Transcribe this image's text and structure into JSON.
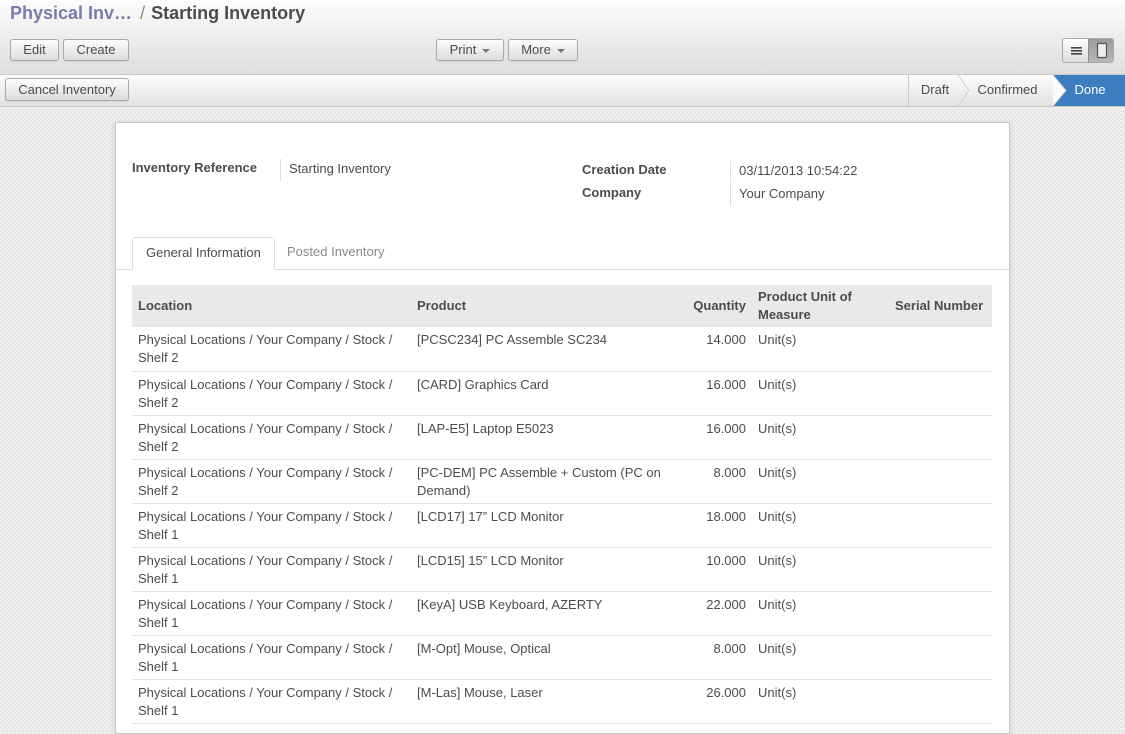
{
  "breadcrumb": {
    "parent": "Physical Inv…",
    "separator": "/",
    "current": "Starting Inventory"
  },
  "toolbar": {
    "edit": "Edit",
    "create": "Create",
    "print": "Print",
    "more": "More"
  },
  "view_switch": {
    "list_icon": "list-view-icon",
    "form_icon": "form-view-icon",
    "active": "form"
  },
  "status_bar": {
    "cancel": "Cancel Inventory",
    "steps": [
      "Draft",
      "Confirmed",
      "Done"
    ],
    "current": "Done",
    "current_color": "#3c7dc0"
  },
  "form": {
    "inventory_reference": {
      "label": "Inventory Reference",
      "value": "Starting Inventory"
    },
    "creation_date": {
      "label": "Creation Date",
      "value": "03/11/2013 10:54:22"
    },
    "company": {
      "label": "Company",
      "value": "Your Company"
    }
  },
  "tabs": [
    {
      "label": "General Information",
      "active": true
    },
    {
      "label": "Posted Inventory",
      "active": false
    }
  ],
  "table": {
    "columns": [
      "Location",
      "Product",
      "Quantity",
      "Product Unit of Measure",
      "Serial Number"
    ],
    "rows": [
      {
        "location": "Physical Locations / Your Company / Stock / Shelf 2",
        "product": "[PCSC234] PC Assemble SC234",
        "quantity": "14.000",
        "uom": "Unit(s)",
        "serial": ""
      },
      {
        "location": "Physical Locations / Your Company / Stock / Shelf 2",
        "product": "[CARD] Graphics Card",
        "quantity": "16.000",
        "uom": "Unit(s)",
        "serial": ""
      },
      {
        "location": "Physical Locations / Your Company / Stock / Shelf 2",
        "product": "[LAP-E5] Laptop E5023",
        "quantity": "16.000",
        "uom": "Unit(s)",
        "serial": ""
      },
      {
        "location": "Physical Locations / Your Company / Stock / Shelf 2",
        "product": "[PC-DEM] PC Assemble + Custom (PC on Demand)",
        "quantity": "8.000",
        "uom": "Unit(s)",
        "serial": ""
      },
      {
        "location": "Physical Locations / Your Company / Stock / Shelf 1",
        "product": "[LCD17] 17” LCD Monitor",
        "quantity": "18.000",
        "uom": "Unit(s)",
        "serial": ""
      },
      {
        "location": "Physical Locations / Your Company / Stock / Shelf 1",
        "product": "[LCD15] 15” LCD Monitor",
        "quantity": "10.000",
        "uom": "Unit(s)",
        "serial": ""
      },
      {
        "location": "Physical Locations / Your Company / Stock / Shelf 1",
        "product": "[KeyA] USB Keyboard, AZERTY",
        "quantity": "22.000",
        "uom": "Unit(s)",
        "serial": ""
      },
      {
        "location": "Physical Locations / Your Company / Stock / Shelf 1",
        "product": "[M-Opt] Mouse, Optical",
        "quantity": "8.000",
        "uom": "Unit(s)",
        "serial": ""
      },
      {
        "location": "Physical Locations / Your Company / Stock / Shelf 1",
        "product": "[M-Las] Mouse, Laser",
        "quantity": "26.000",
        "uom": "Unit(s)",
        "serial": ""
      }
    ]
  }
}
